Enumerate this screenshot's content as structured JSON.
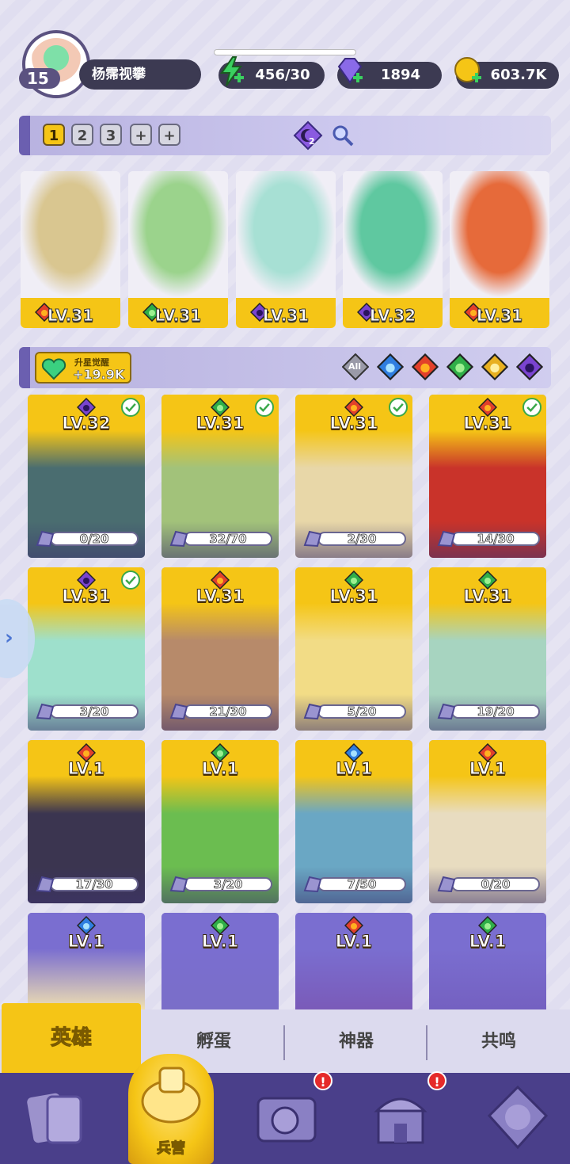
{
  "header": {
    "player_level": "15",
    "player_name": "杨霈视攀",
    "energy": "456/30",
    "gems": "1894",
    "gold": "603.7K"
  },
  "team_tabs": [
    "1",
    "2",
    "3",
    "+",
    "+"
  ],
  "team_badge": "2",
  "top_heroes": [
    {
      "level": "LV.31",
      "element": "fire",
      "color": "#d9c690"
    },
    {
      "level": "LV.31",
      "element": "nature",
      "color": "#9bd38c"
    },
    {
      "level": "LV.31",
      "element": "dark",
      "color": "#a7e0d4"
    },
    {
      "level": "LV.32",
      "element": "dark",
      "color": "#5fc8a0"
    },
    {
      "level": "LV.31",
      "element": "fire",
      "color": "#e66a3a"
    }
  ],
  "awaken": {
    "label": "升星觉醒",
    "value": "+19.9K"
  },
  "filters": {
    "all": "All",
    "items": [
      "water",
      "fire",
      "nature",
      "light",
      "dark"
    ]
  },
  "cards": [
    {
      "level": "LV.32",
      "element": "dark",
      "checked": true,
      "progress": "0/20",
      "tone": "#4a6d70"
    },
    {
      "level": "LV.31",
      "element": "nature",
      "checked": true,
      "progress": "32/70",
      "tone": "#a2c27a"
    },
    {
      "level": "LV.31",
      "element": "fire",
      "checked": true,
      "progress": "2/30",
      "tone": "#e8d7a8"
    },
    {
      "level": "LV.31",
      "element": "fire",
      "checked": true,
      "progress": "14/30",
      "tone": "#c9332a"
    },
    {
      "level": "LV.31",
      "element": "dark",
      "checked": true,
      "progress": "3/20",
      "tone": "#9ee0cc"
    },
    {
      "level": "LV.31",
      "element": "fire",
      "checked": false,
      "progress": "21/30",
      "tone": "#b78a6a"
    },
    {
      "level": "LV.31",
      "element": "nature",
      "checked": false,
      "progress": "5/20",
      "tone": "#f2dc86"
    },
    {
      "level": "LV.31",
      "element": "nature",
      "checked": false,
      "progress": "19/20",
      "tone": "#a7d4c0"
    },
    {
      "level": "LV.1",
      "element": "fire",
      "checked": false,
      "progress": "17/30",
      "tone": "#3b3550"
    },
    {
      "level": "LV.1",
      "element": "nature",
      "checked": false,
      "progress": "3/20",
      "tone": "#6bbd50"
    },
    {
      "level": "LV.1",
      "element": "water",
      "checked": false,
      "progress": "7/50",
      "tone": "#6aa7c4"
    },
    {
      "level": "LV.1",
      "element": "fire",
      "checked": false,
      "progress": "0/20",
      "tone": "#e8dcc0"
    },
    {
      "level": "LV.1",
      "element": "water",
      "checked": false,
      "progress": "",
      "tone": "#f2e2b0"
    },
    {
      "level": "LV.1",
      "element": "nature",
      "checked": false,
      "progress": "",
      "tone": "#7a6ec8"
    },
    {
      "level": "LV.1",
      "element": "fire",
      "checked": false,
      "progress": "",
      "tone": "#7a5ab8"
    },
    {
      "level": "LV.1",
      "element": "nature",
      "checked": false,
      "progress": "",
      "tone": "#7460c0"
    }
  ],
  "bottom_tabs": [
    "英雄",
    "孵蛋",
    "神器",
    "共鸣"
  ],
  "nav": {
    "center_label": "兵营",
    "alerts": [
      "!",
      "!"
    ]
  },
  "colors": {
    "accent": "#f5c516",
    "nav": "#4a3f8a",
    "strip": "#6b5fb0"
  }
}
